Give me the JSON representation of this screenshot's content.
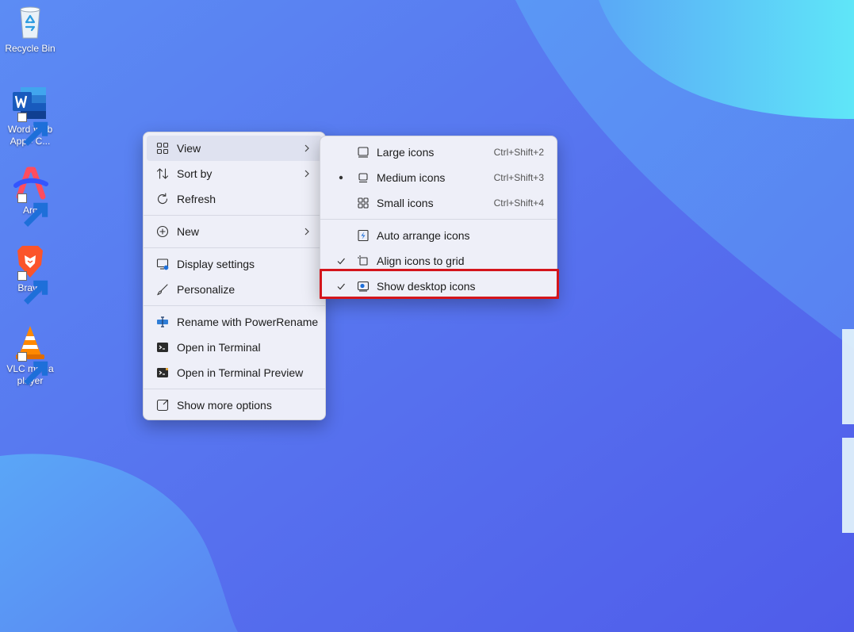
{
  "desktop": {
    "icons": [
      {
        "label": "Recycle Bin",
        "icon": "recycle-bin-icon"
      },
      {
        "label": "Word Web App - C...",
        "icon": "word-icon"
      },
      {
        "label": "Arc",
        "icon": "arc-icon"
      },
      {
        "label": "Brave",
        "icon": "brave-icon"
      },
      {
        "label": "VLC media player",
        "icon": "vlc-icon"
      }
    ]
  },
  "context_menu": {
    "items": [
      {
        "label": "View",
        "icon": "grid-icon",
        "has_submenu": true
      },
      {
        "label": "Sort by",
        "icon": "sort-icon",
        "has_submenu": true
      },
      {
        "label": "Refresh",
        "icon": "refresh-icon"
      },
      {
        "label": "New",
        "icon": "add-circle-icon",
        "has_submenu": true
      },
      {
        "label": "Display settings",
        "icon": "display-icon"
      },
      {
        "label": "Personalize",
        "icon": "brush-icon"
      },
      {
        "label": "Rename with PowerRename",
        "icon": "powerrename-icon"
      },
      {
        "label": "Open in Terminal",
        "icon": "terminal-icon"
      },
      {
        "label": "Open in Terminal Preview",
        "icon": "terminal-preview-icon"
      },
      {
        "label": "Show more options",
        "icon": "more-options-icon"
      }
    ]
  },
  "view_submenu": {
    "items": [
      {
        "label": "Large icons",
        "shortcut": "Ctrl+Shift+2",
        "icon": "large-icons-icon",
        "mark": ""
      },
      {
        "label": "Medium icons",
        "shortcut": "Ctrl+Shift+3",
        "icon": "medium-icons-icon",
        "mark": "bullet"
      },
      {
        "label": "Small icons",
        "shortcut": "Ctrl+Shift+4",
        "icon": "small-icons-icon",
        "mark": ""
      },
      {
        "label": "Auto arrange icons",
        "shortcut": "",
        "icon": "auto-arrange-icon",
        "mark": ""
      },
      {
        "label": "Align icons to grid",
        "shortcut": "",
        "icon": "align-grid-icon",
        "mark": "check"
      },
      {
        "label": "Show desktop icons",
        "shortcut": "",
        "icon": "show-desktop-icon",
        "mark": "check"
      }
    ],
    "highlighted_item": "Show desktop icons",
    "highlight_color": "#d4151c"
  },
  "colors": {
    "wallpaper_base": "#5a72f0",
    "wallpaper_accent": "#5fe0f7",
    "menu_background": "#eeeff8"
  }
}
